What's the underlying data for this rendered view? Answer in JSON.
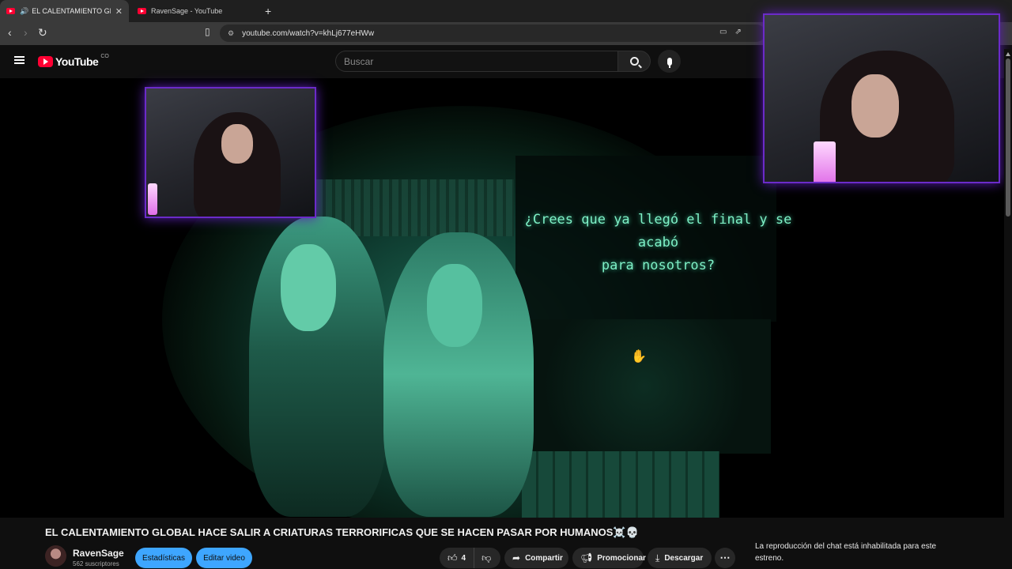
{
  "browser": {
    "tabs": [
      {
        "title": "EL CALENTAMIENTO GLOBAL",
        "active": true,
        "audio": true
      },
      {
        "title": "RavenSage - YouTube",
        "active": false
      }
    ],
    "url": "youtube.com/watch?v=khLj677eHWw"
  },
  "masthead": {
    "logo_text": "YouTube",
    "country_code": "CO",
    "search_placeholder": "Buscar"
  },
  "player": {
    "subtitle_line1": "¿Crees que ya llegó el final y se acabó",
    "subtitle_line2": "para nosotros?"
  },
  "video": {
    "title": "EL CALENTAMIENTO GLOBAL HACE SALIR A CRIATURAS TERRORIFICAS QUE SE HACEN PASAR POR HUMANOS☠️💀",
    "channel_name": "RavenSage",
    "subscribers": "562 suscriptores",
    "buttons": {
      "stats": "Estadísticas",
      "edit": "Editar video",
      "like_count": "4",
      "share": "Compartir",
      "promote": "Promocionar",
      "download": "Descargar"
    }
  },
  "chat": {
    "disabled_notice": "La reproducción del chat está inhabilitada para este estreno."
  },
  "colors": {
    "accent_blue": "#3ea6ff",
    "yt_red": "#ff0033",
    "cam_border": "#6b2bc9",
    "subtitle_green": "#7ef0c6"
  }
}
